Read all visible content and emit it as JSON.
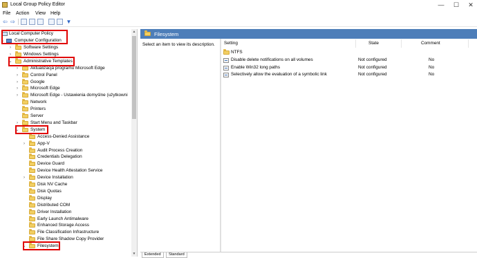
{
  "window": {
    "title": "Local Group Policy Editor",
    "minimize": "—",
    "maximize": "☐",
    "close": "✕"
  },
  "menu": [
    "File",
    "Action",
    "View",
    "Help"
  ],
  "toolbar": {
    "icons": [
      "back-arrow-icon",
      "forward-arrow-icon",
      "up-folder-icon",
      "show-hide-tree-icon",
      "properties-icon",
      "help-icon",
      "export-list-icon",
      "filter-icon"
    ]
  },
  "tree": {
    "root": "Local Computer Policy",
    "computer_config": "Computer Configuration",
    "items": [
      {
        "label": "Software Settings",
        "indent": 1
      },
      {
        "label": "Windows Settings",
        "indent": 1
      },
      {
        "label": "Administrative Templates",
        "indent": 1
      },
      {
        "label": "Aktualizacja programu Microsoft Edge",
        "indent": 2
      },
      {
        "label": "Control Panel",
        "indent": 2
      },
      {
        "label": "Google",
        "indent": 2
      },
      {
        "label": "Microsoft Edge",
        "indent": 2
      },
      {
        "label": "Microsoft Edge - Ustawienia domyślne (użytkowni",
        "indent": 2
      },
      {
        "label": "Network",
        "indent": 2
      },
      {
        "label": "Printers",
        "indent": 2
      },
      {
        "label": "Server",
        "indent": 2
      },
      {
        "label": "Start Menu and Taskbar",
        "indent": 2
      },
      {
        "label": "System",
        "indent": 2
      },
      {
        "label": "Access-Denied Assistance",
        "indent": 3
      },
      {
        "label": "App-V",
        "indent": 3
      },
      {
        "label": "Audit Process Creation",
        "indent": 3
      },
      {
        "label": "Credentials Delegation",
        "indent": 3
      },
      {
        "label": "Device Guard",
        "indent": 3
      },
      {
        "label": "Device Health Attestation Service",
        "indent": 3
      },
      {
        "label": "Device Installation",
        "indent": 3
      },
      {
        "label": "Disk NV Cache",
        "indent": 3
      },
      {
        "label": "Disk Quotas",
        "indent": 3
      },
      {
        "label": "Display",
        "indent": 3
      },
      {
        "label": "Distributed COM",
        "indent": 3
      },
      {
        "label": "Driver Installation",
        "indent": 3
      },
      {
        "label": "Early Launch Antimalware",
        "indent": 3
      },
      {
        "label": "Enhanced Storage Access",
        "indent": 3
      },
      {
        "label": "File Classification Infrastructure",
        "indent": 3
      },
      {
        "label": "File Share Shadow Copy Provider",
        "indent": 3
      },
      {
        "label": "Filesystem",
        "indent": 3
      }
    ]
  },
  "right": {
    "header": "Filesystem",
    "description": "Select an item to view its description.",
    "columns": {
      "setting": "Setting",
      "state": "State",
      "comment": "Comment"
    },
    "rows": [
      {
        "setting": "NTFS",
        "state": "",
        "comment": "",
        "folder": true
      },
      {
        "setting": "Disable delete notifications on all volumes",
        "state": "Not configured",
        "comment": "No"
      },
      {
        "setting": "Enable Win32 long paths",
        "state": "Not configured",
        "comment": "No"
      },
      {
        "setting": "Selectively allow the evaluation of a symbolic link",
        "state": "Not configured",
        "comment": "No"
      }
    ],
    "tabs": [
      "Extended",
      "Standard"
    ]
  },
  "colors": {
    "accent_header": "#4d7eb9",
    "highlight": "#e00000",
    "folder": "#f2cf63"
  }
}
